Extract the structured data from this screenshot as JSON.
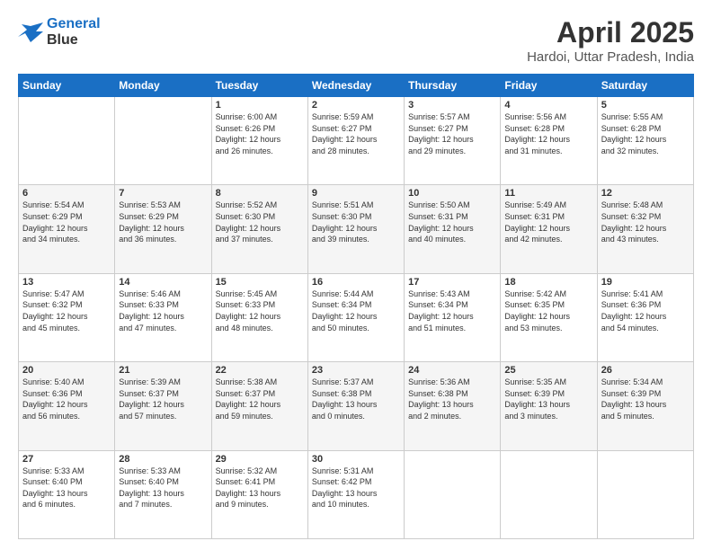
{
  "logo": {
    "line1": "General",
    "line2": "Blue"
  },
  "title": "April 2025",
  "subtitle": "Hardoi, Uttar Pradesh, India",
  "header_days": [
    "Sunday",
    "Monday",
    "Tuesday",
    "Wednesday",
    "Thursday",
    "Friday",
    "Saturday"
  ],
  "weeks": [
    [
      {
        "day": "",
        "info": ""
      },
      {
        "day": "",
        "info": ""
      },
      {
        "day": "1",
        "info": "Sunrise: 6:00 AM\nSunset: 6:26 PM\nDaylight: 12 hours\nand 26 minutes."
      },
      {
        "day": "2",
        "info": "Sunrise: 5:59 AM\nSunset: 6:27 PM\nDaylight: 12 hours\nand 28 minutes."
      },
      {
        "day": "3",
        "info": "Sunrise: 5:57 AM\nSunset: 6:27 PM\nDaylight: 12 hours\nand 29 minutes."
      },
      {
        "day": "4",
        "info": "Sunrise: 5:56 AM\nSunset: 6:28 PM\nDaylight: 12 hours\nand 31 minutes."
      },
      {
        "day": "5",
        "info": "Sunrise: 5:55 AM\nSunset: 6:28 PM\nDaylight: 12 hours\nand 32 minutes."
      }
    ],
    [
      {
        "day": "6",
        "info": "Sunrise: 5:54 AM\nSunset: 6:29 PM\nDaylight: 12 hours\nand 34 minutes."
      },
      {
        "day": "7",
        "info": "Sunrise: 5:53 AM\nSunset: 6:29 PM\nDaylight: 12 hours\nand 36 minutes."
      },
      {
        "day": "8",
        "info": "Sunrise: 5:52 AM\nSunset: 6:30 PM\nDaylight: 12 hours\nand 37 minutes."
      },
      {
        "day": "9",
        "info": "Sunrise: 5:51 AM\nSunset: 6:30 PM\nDaylight: 12 hours\nand 39 minutes."
      },
      {
        "day": "10",
        "info": "Sunrise: 5:50 AM\nSunset: 6:31 PM\nDaylight: 12 hours\nand 40 minutes."
      },
      {
        "day": "11",
        "info": "Sunrise: 5:49 AM\nSunset: 6:31 PM\nDaylight: 12 hours\nand 42 minutes."
      },
      {
        "day": "12",
        "info": "Sunrise: 5:48 AM\nSunset: 6:32 PM\nDaylight: 12 hours\nand 43 minutes."
      }
    ],
    [
      {
        "day": "13",
        "info": "Sunrise: 5:47 AM\nSunset: 6:32 PM\nDaylight: 12 hours\nand 45 minutes."
      },
      {
        "day": "14",
        "info": "Sunrise: 5:46 AM\nSunset: 6:33 PM\nDaylight: 12 hours\nand 47 minutes."
      },
      {
        "day": "15",
        "info": "Sunrise: 5:45 AM\nSunset: 6:33 PM\nDaylight: 12 hours\nand 48 minutes."
      },
      {
        "day": "16",
        "info": "Sunrise: 5:44 AM\nSunset: 6:34 PM\nDaylight: 12 hours\nand 50 minutes."
      },
      {
        "day": "17",
        "info": "Sunrise: 5:43 AM\nSunset: 6:34 PM\nDaylight: 12 hours\nand 51 minutes."
      },
      {
        "day": "18",
        "info": "Sunrise: 5:42 AM\nSunset: 6:35 PM\nDaylight: 12 hours\nand 53 minutes."
      },
      {
        "day": "19",
        "info": "Sunrise: 5:41 AM\nSunset: 6:36 PM\nDaylight: 12 hours\nand 54 minutes."
      }
    ],
    [
      {
        "day": "20",
        "info": "Sunrise: 5:40 AM\nSunset: 6:36 PM\nDaylight: 12 hours\nand 56 minutes."
      },
      {
        "day": "21",
        "info": "Sunrise: 5:39 AM\nSunset: 6:37 PM\nDaylight: 12 hours\nand 57 minutes."
      },
      {
        "day": "22",
        "info": "Sunrise: 5:38 AM\nSunset: 6:37 PM\nDaylight: 12 hours\nand 59 minutes."
      },
      {
        "day": "23",
        "info": "Sunrise: 5:37 AM\nSunset: 6:38 PM\nDaylight: 13 hours\nand 0 minutes."
      },
      {
        "day": "24",
        "info": "Sunrise: 5:36 AM\nSunset: 6:38 PM\nDaylight: 13 hours\nand 2 minutes."
      },
      {
        "day": "25",
        "info": "Sunrise: 5:35 AM\nSunset: 6:39 PM\nDaylight: 13 hours\nand 3 minutes."
      },
      {
        "day": "26",
        "info": "Sunrise: 5:34 AM\nSunset: 6:39 PM\nDaylight: 13 hours\nand 5 minutes."
      }
    ],
    [
      {
        "day": "27",
        "info": "Sunrise: 5:33 AM\nSunset: 6:40 PM\nDaylight: 13 hours\nand 6 minutes."
      },
      {
        "day": "28",
        "info": "Sunrise: 5:33 AM\nSunset: 6:40 PM\nDaylight: 13 hours\nand 7 minutes."
      },
      {
        "day": "29",
        "info": "Sunrise: 5:32 AM\nSunset: 6:41 PM\nDaylight: 13 hours\nand 9 minutes."
      },
      {
        "day": "30",
        "info": "Sunrise: 5:31 AM\nSunset: 6:42 PM\nDaylight: 13 hours\nand 10 minutes."
      },
      {
        "day": "",
        "info": ""
      },
      {
        "day": "",
        "info": ""
      },
      {
        "day": "",
        "info": ""
      }
    ]
  ]
}
